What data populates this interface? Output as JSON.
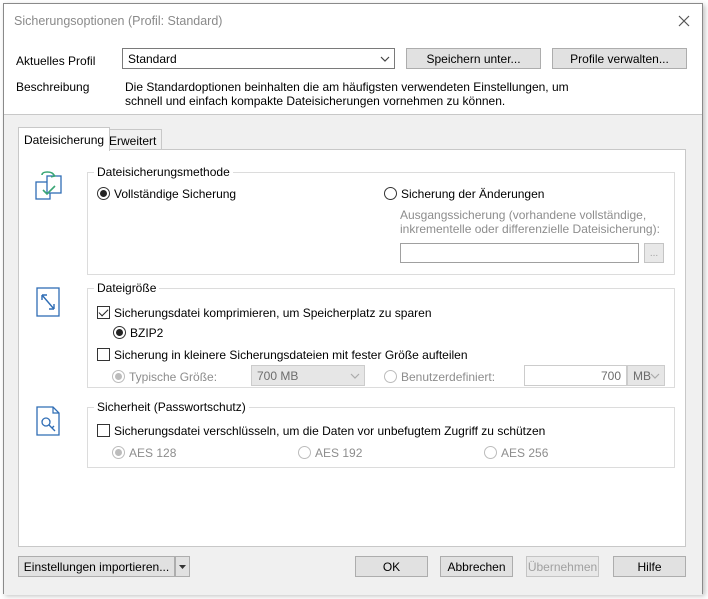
{
  "window": {
    "title": "Sicherungsoptionen (Profil: Standard)"
  },
  "header": {
    "profile_label": "Aktuelles Profil",
    "profile_value": "Standard",
    "save_as_label": "Speichern unter...",
    "manage_label": "Profile verwalten...",
    "description_label": "Beschreibung",
    "description_line1": "Die Standardoptionen beinhalten die am häufigsten verwendeten Einstellungen, um",
    "description_line2": "schnell und einfach kompakte Dateisicherungen vornehmen zu können."
  },
  "tabs": [
    {
      "label": "Dateisicherung",
      "active": true
    },
    {
      "label": "Erweitert",
      "active": false
    }
  ],
  "method": {
    "title": "Dateisicherungsmethode",
    "full_label": "Vollständige Sicherung",
    "diff_label": "Sicherung der Änderungen",
    "source_hint_line1": "Ausgangssicherung (vorhandene vollständige,",
    "source_hint_line2": "inkrementelle oder differenzielle Dateisicherung):",
    "source_value": "",
    "browse_label": "..."
  },
  "size": {
    "title": "Dateigröße",
    "compress_label": "Sicherungsdatei komprimieren, um Speicherplatz zu sparen",
    "bzip2_label": "BZIP2",
    "split_label": "Sicherung in kleinere Sicherungsdateien mit fester Größe aufteilen",
    "typical_label": "Typische Größe:",
    "typical_value": "700 MB",
    "custom_label": "Benutzerdefiniert:",
    "custom_value": "700",
    "unit_value": "MB"
  },
  "security": {
    "title": "Sicherheit (Passwortschutz)",
    "encrypt_label": "Sicherungsdatei verschlüsseln, um die Daten vor unbefugtem Zugriff zu schützen",
    "aes128_label": "AES 128",
    "aes192_label": "AES 192",
    "aes256_label": "AES 256"
  },
  "footer": {
    "import_label": "Einstellungen importieren...",
    "ok_label": "OK",
    "cancel_label": "Abbrechen",
    "apply_label": "Übernehmen",
    "help_label": "Hilfe"
  },
  "colors": {
    "icon_blue": "#2f6db5",
    "icon_green": "#3aa676",
    "disabled_text": "#8d8d8d"
  },
  "icons": [
    "close-icon",
    "chevron-down-icon",
    "backup-method-icon",
    "resize-icon",
    "lock-file-icon"
  ]
}
